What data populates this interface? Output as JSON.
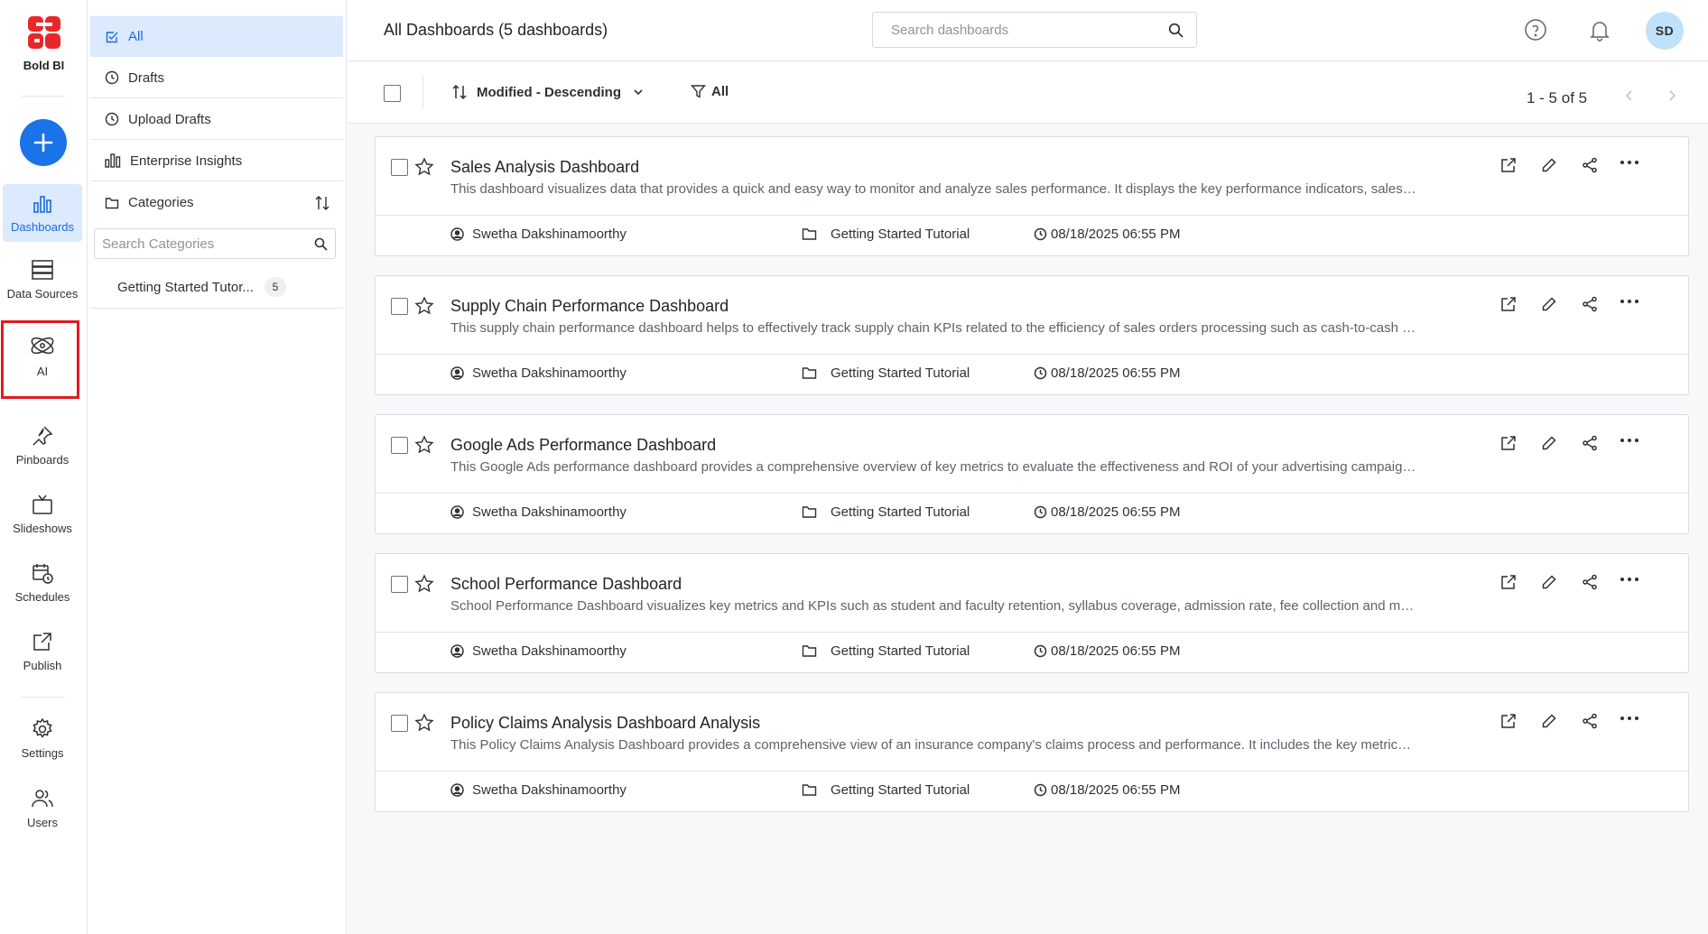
{
  "app": {
    "name": "Bold BI"
  },
  "rail": {
    "create_label": "+",
    "items": [
      {
        "key": "dashboards",
        "label": "Dashboards"
      },
      {
        "key": "datasources",
        "label": "Data Sources"
      },
      {
        "key": "ai",
        "label": "AI"
      },
      {
        "key": "pinboards",
        "label": "Pinboards"
      },
      {
        "key": "slideshows",
        "label": "Slideshows"
      },
      {
        "key": "schedules",
        "label": "Schedules"
      },
      {
        "key": "publish",
        "label": "Publish"
      },
      {
        "key": "settings",
        "label": "Settings"
      },
      {
        "key": "users",
        "label": "Users"
      }
    ]
  },
  "categories_panel": {
    "items": [
      {
        "label": "All"
      },
      {
        "label": "Drafts"
      },
      {
        "label": "Upload Drafts"
      },
      {
        "label": "Enterprise Insights"
      },
      {
        "label": "Categories"
      }
    ],
    "search_placeholder": "Search Categories",
    "subcategories": [
      {
        "label": "Getting Started Tutor...",
        "count": "5"
      }
    ]
  },
  "header": {
    "title": "All Dashboards (5 dashboards)",
    "search_placeholder": "Search dashboards",
    "avatar_initials": "SD"
  },
  "toolbar": {
    "sort_label": "Modified - Descending",
    "filter_label": "All",
    "pagination": "1 - 5 of 5"
  },
  "dashboards": [
    {
      "title": "Sales Analysis Dashboard",
      "description": "This dashboard visualizes data that provides a quick and easy way to monitor and analyze sales performance. It displays the key performance indicators, sales trends and product insights.",
      "owner": "Swetha Dakshinamoorthy",
      "category": "Getting Started Tutorial",
      "modified": "08/18/2025 06:55 PM"
    },
    {
      "title": "Supply Chain Performance Dashboard",
      "description": "This supply chain performance dashboard helps to effectively track supply chain KPIs related to the efficiency of sales orders processing such as cash-to-cash cycle time and inventory levels.",
      "owner": "Swetha Dakshinamoorthy",
      "category": "Getting Started Tutorial",
      "modified": "08/18/2025 06:55 PM"
    },
    {
      "title": "Google Ads Performance Dashboard",
      "description": "This Google Ads performance dashboard provides a comprehensive overview of key metrics to evaluate the effectiveness and ROI of your advertising campaigns across channels.",
      "owner": "Swetha Dakshinamoorthy",
      "category": "Getting Started Tutorial",
      "modified": "08/18/2025 06:55 PM"
    },
    {
      "title": "School Performance Dashboard",
      "description": "School Performance Dashboard visualizes key metrics and KPIs such as student and faculty retention, syllabus coverage, admission rate, fee collection and more.",
      "owner": "Swetha Dakshinamoorthy",
      "category": "Getting Started Tutorial",
      "modified": "08/18/2025 06:55 PM"
    },
    {
      "title": "Policy Claims Analysis Dashboard Analysis",
      "description": "This Policy Claims Analysis Dashboard provides a comprehensive view of an insurance company's claims process and performance. It includes the key metrics and trends over time.",
      "owner": "Swetha Dakshinamoorthy",
      "category": "Getting Started Tutorial",
      "modified": "08/18/2025 06:55 PM"
    }
  ]
}
